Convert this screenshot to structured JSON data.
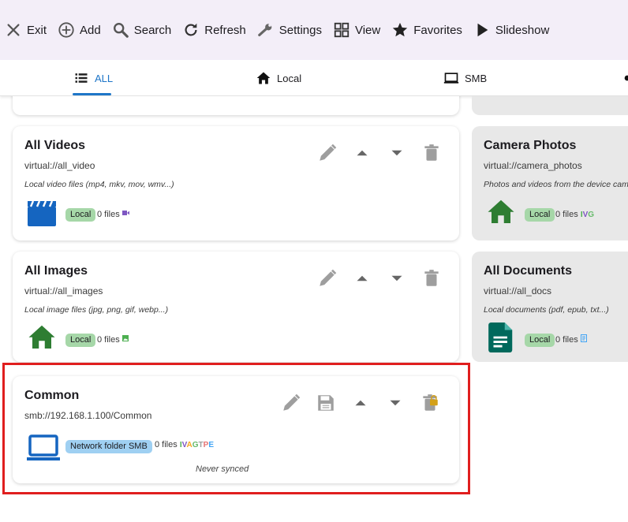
{
  "toolbar": {
    "items": [
      {
        "label": "Exit",
        "icon": "close-icon"
      },
      {
        "label": "Add",
        "icon": "add-circle-icon"
      },
      {
        "label": "Search",
        "icon": "search-icon"
      },
      {
        "label": "Refresh",
        "icon": "refresh-icon"
      },
      {
        "label": "Settings",
        "icon": "wrench-icon"
      },
      {
        "label": "View",
        "icon": "grid-view-icon"
      },
      {
        "label": "Favorites",
        "icon": "star-icon"
      },
      {
        "label": "Slideshow",
        "icon": "play-icon"
      }
    ]
  },
  "tabs": [
    {
      "label": "ALL",
      "icon": "list-icon",
      "active": true
    },
    {
      "label": "Local",
      "icon": "home-icon",
      "active": false
    },
    {
      "label": "SMB",
      "icon": "laptop-icon",
      "active": false
    }
  ],
  "cards": {
    "all_videos": {
      "title": "All Videos",
      "path": "virtual://all_video",
      "description": "Local video files (mp4, mkv, mov, wmv...)",
      "badge": "Local",
      "files": "0 files",
      "icon": "clapperboard-icon"
    },
    "all_images": {
      "title": "All Images",
      "path": "virtual://all_images",
      "description": "Local image files (jpg, png, gif, webp...)",
      "badge": "Local",
      "files": "0 files",
      "icon": "home-icon"
    },
    "common": {
      "title": "Common",
      "path": "smb://192.168.1.100/Common",
      "badge": "Network folder SMB",
      "files": "0 files",
      "file_types": [
        {
          "letter": "I",
          "color": "#4caf50"
        },
        {
          "letter": "V",
          "color": "#7e57c2"
        },
        {
          "letter": "A",
          "color": "#f5a623"
        },
        {
          "letter": "G",
          "color": "#66bb6a"
        },
        {
          "letter": "T",
          "color": "#9e9e9e"
        },
        {
          "letter": "P",
          "color": "#e57373"
        },
        {
          "letter": "E",
          "color": "#42a5f5"
        }
      ],
      "sync_status": "Never synced",
      "icon": "laptop-icon"
    },
    "camera_photos": {
      "title": "Camera Photos",
      "path": "virtual://camera_photos",
      "description": "Photos and videos from the device camera",
      "badge": "Local",
      "files": "0 files",
      "file_types": [
        {
          "letter": "I",
          "color": "#4caf50"
        },
        {
          "letter": "V",
          "color": "#7e57c2"
        },
        {
          "letter": "G",
          "color": "#66bb6a"
        }
      ],
      "icon": "home-icon"
    },
    "all_documents": {
      "title": "All Documents",
      "path": "virtual://all_docs",
      "description": "Local documents (pdf, epub, txt...)",
      "badge": "Local",
      "files": "0 files",
      "icon": "document-icon"
    }
  }
}
